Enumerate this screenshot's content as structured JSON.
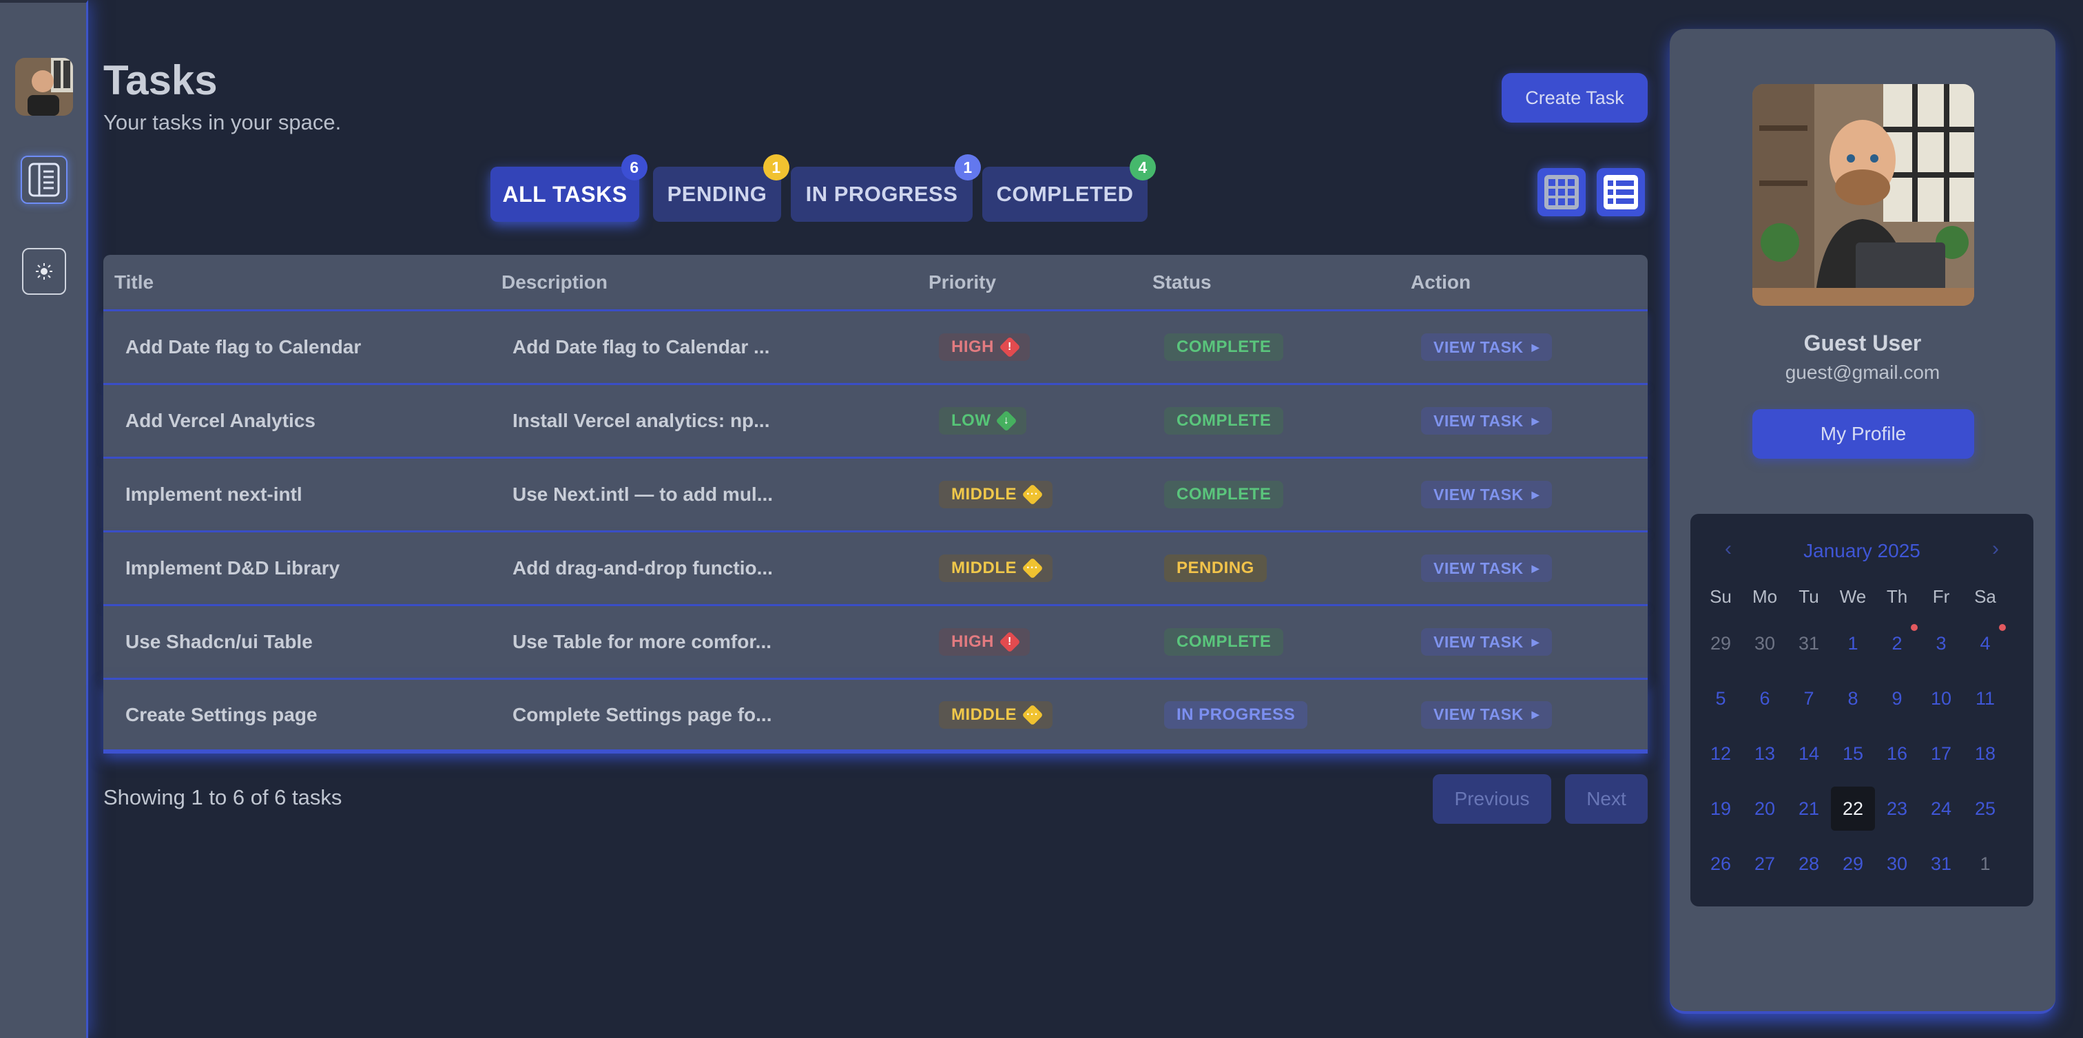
{
  "header": {
    "title": "Tasks",
    "subtitle": "Your tasks in your space.",
    "create_label": "Create Task"
  },
  "tabs": [
    {
      "label": "ALL TASKS",
      "count": "6",
      "badge_color": "#3c4fd4",
      "active": true
    },
    {
      "label": "PENDING",
      "count": "1",
      "badge_color": "#f1c230",
      "active": false
    },
    {
      "label": "IN PROGRESS",
      "count": "1",
      "badge_color": "#6378ee",
      "active": false
    },
    {
      "label": "COMPLETED",
      "count": "4",
      "badge_color": "#46b86c",
      "active": false
    }
  ],
  "table": {
    "headers": [
      "Title",
      "Description",
      "Priority",
      "Status",
      "Action"
    ],
    "rows": [
      {
        "title": "Add Date flag to Calendar",
        "description": "Add Date flag to Calendar ...",
        "priority": "HIGH",
        "priority_icon": "exclamation-icon",
        "status": "COMPLETE",
        "action": "VIEW TASK"
      },
      {
        "title": "Add Vercel Analytics",
        "description": "Install Vercel analytics: np...",
        "priority": "LOW",
        "priority_icon": "arrow-down-icon",
        "status": "COMPLETE",
        "action": "VIEW TASK"
      },
      {
        "title": "Implement next-intl",
        "description": "Use Next.intl — to add mul...",
        "priority": "MIDDLE",
        "priority_icon": "dots-icon",
        "status": "COMPLETE",
        "action": "VIEW TASK"
      },
      {
        "title": "Implement D&D Library",
        "description": "Add drag-and-drop functio...",
        "priority": "MIDDLE",
        "priority_icon": "dots-icon",
        "status": "PENDING",
        "action": "VIEW TASK"
      },
      {
        "title": "Use Shadcn/ui Table",
        "description": "Use Table for more comfor...",
        "priority": "HIGH",
        "priority_icon": "exclamation-icon",
        "status": "COMPLETE",
        "action": "VIEW TASK"
      },
      {
        "title": "Create Settings page",
        "description": "Complete Settings page fo...",
        "priority": "MIDDLE",
        "priority_icon": "dots-icon",
        "status": "IN PROGRESS",
        "action": "VIEW TASK"
      }
    ]
  },
  "footer": {
    "showing": "Showing 1 to 6 of 6 tasks",
    "previous": "Previous",
    "next": "Next"
  },
  "profile": {
    "name": "Guest User",
    "email": "guest@gmail.com",
    "button": "My Profile"
  },
  "calendar": {
    "month": "January 2025",
    "prev_icon": "chevron-left-icon",
    "next_icon": "chevron-right-icon",
    "weekdays": [
      "Su",
      "Mo",
      "Tu",
      "We",
      "Th",
      "Fr",
      "Sa"
    ],
    "weeks": [
      [
        "29",
        "30",
        "31",
        "1",
        "2",
        "3",
        "4"
      ],
      [
        "5",
        "6",
        "7",
        "8",
        "9",
        "10",
        "11"
      ],
      [
        "12",
        "13",
        "14",
        "15",
        "16",
        "17",
        "18"
      ],
      [
        "19",
        "20",
        "21",
        "22",
        "23",
        "24",
        "25"
      ],
      [
        "26",
        "27",
        "28",
        "29",
        "30",
        "31",
        "1"
      ]
    ],
    "muted_dates": [
      "29-w0",
      "30-w0",
      "31-w0",
      "1-w4"
    ],
    "today": "22",
    "flagged": [
      "2",
      "4"
    ]
  },
  "rail": {
    "icons": [
      "avatar",
      "sidebar-toggle-icon",
      "sun-icon"
    ]
  }
}
